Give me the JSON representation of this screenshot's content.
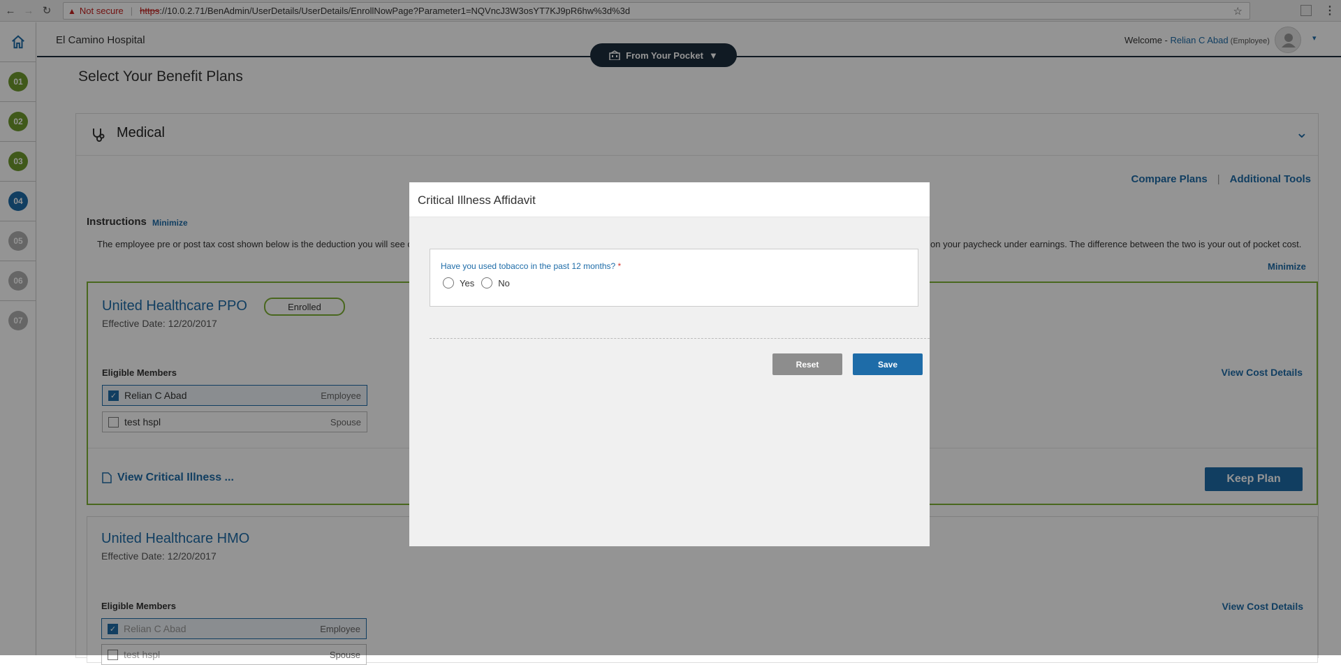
{
  "browser": {
    "back": "←",
    "forward": "→",
    "reload": "↻",
    "security_label": "Not secure",
    "url_scheme": "https",
    "url_rest": "://10.0.2.71/BenAdmin/UserDetails/UserDetails/EnrollNowPage?Parameter1=NQVncJ3W3osYT7KJ9pR6hw%3d%3d",
    "bookmark_icon": "☆",
    "menu_icon": "⋮"
  },
  "sidebar": {
    "home_icon": "home-icon",
    "steps": [
      {
        "label": "01",
        "color": "#6e9a2e"
      },
      {
        "label": "02",
        "color": "#6e9a2e"
      },
      {
        "label": "03",
        "color": "#6e9a2e"
      },
      {
        "label": "04",
        "color": "#1e6ca8"
      },
      {
        "label": "05",
        "color": "#b0b0b0"
      },
      {
        "label": "06",
        "color": "#b0b0b0"
      },
      {
        "label": "07",
        "color": "#b0b0b0"
      }
    ]
  },
  "header": {
    "org_name": "El Camino Hospital",
    "welcome_prefix": "Welcome - ",
    "user_name": "Relian C Abad",
    "user_role": " (Employee)",
    "pocket_label": "From Your Pocket",
    "pocket_caret": "▼",
    "account_caret": "▾"
  },
  "main": {
    "page_title": "Select Your Benefit Plans",
    "section_title": "Medical",
    "collapse_icon": "⌄",
    "compare_plans": "Compare Plans",
    "tools_sep": "|",
    "additional_tools": "Additional Tools",
    "instructions_label": "Instructions",
    "instructions_minimize": "Minimize",
    "instructions_text_left": "The employee pre or post tax cost shown below is the deduction you will see c",
    "instructions_text_right": "on your paycheck under earnings. The difference between the two is your out of pocket cost.",
    "minimize2": "Minimize",
    "plans": [
      {
        "name": "United Healthcare PPO",
        "badge": "Enrolled",
        "effective": "Effective Date: 12/20/2017",
        "eligible_label": "Eligible Members",
        "members": [
          {
            "name": "Relian C Abad",
            "role": "Employee",
            "checked": "✓"
          },
          {
            "name": "test hspl",
            "role": "Spouse",
            "checked": ""
          }
        ],
        "view_cost": "View Cost Details",
        "view_ci": "View Critical Illness ...",
        "keep_plan": "Keep Plan"
      },
      {
        "name": "United Healthcare HMO",
        "effective": "Effective Date: 12/20/2017",
        "eligible_label": "Eligible Members",
        "members": [
          {
            "name": "Relian C Abad",
            "role": "Employee",
            "checked": "✓"
          },
          {
            "name": "test hspl",
            "role": "Spouse",
            "checked": ""
          }
        ],
        "view_cost": "View Cost Details"
      }
    ]
  },
  "modal": {
    "title": "Critical Illness Affidavit",
    "question": "Have you used tobacco in the past 12 months?",
    "required_mark": " *",
    "options": [
      "Yes",
      "No"
    ],
    "reset_label": "Reset",
    "save_label": "Save"
  },
  "colors": {
    "accent": "#1e6ca8",
    "navy": "#1d2d3d",
    "green": "#7fb134"
  }
}
